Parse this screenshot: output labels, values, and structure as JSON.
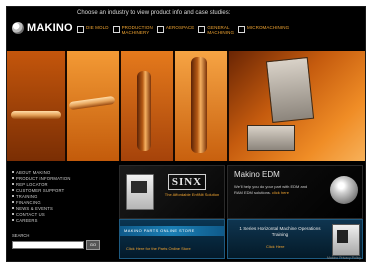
{
  "brand": {
    "name": "MAKINO"
  },
  "header": {
    "tagline": "Choose an industry to view product info and case studies:",
    "industries": [
      {
        "label": "DIE MOLD"
      },
      {
        "label": "PRODUCTION\nMACHINERY"
      },
      {
        "label": "AEROSPACE"
      },
      {
        "label": "GENERAL\nMACHINING"
      },
      {
        "label": "MICROMACHINING"
      }
    ]
  },
  "nav": {
    "items": [
      {
        "label": "ABOUT MAKINO"
      },
      {
        "label": "PRODUCT INFORMATION"
      },
      {
        "label": "REP LOCATOR"
      },
      {
        "label": "CUSTOMER SUPPORT"
      },
      {
        "label": "TRAINING"
      },
      {
        "label": "FINANCING"
      },
      {
        "label": "NEWS & EVENTS"
      },
      {
        "label": "CONTACT US"
      },
      {
        "label": "CAREERS"
      }
    ],
    "search_label": "SEARCH",
    "search_button": "GO"
  },
  "promos": {
    "sinx": {
      "logo": "SINX",
      "tagline": "The Affordable EnfiNit Solution"
    },
    "parts": {
      "title": "MAKINO PARTS ONLINE STORE",
      "link": "Click Here for the Parts Online Store"
    },
    "edm": {
      "title": "Makino EDM",
      "text": "We'll help you do your part with EDM and RAM EDM solutions.",
      "link": "click here"
    },
    "series": {
      "title": "1 Series Horizontal Machine Operations Training",
      "link": "Click Here"
    }
  },
  "footer": {
    "note": "Makino Privacy Policy"
  },
  "colors": {
    "accent": "#f0a431",
    "background": "#000000",
    "hero": "#e77c1d"
  }
}
